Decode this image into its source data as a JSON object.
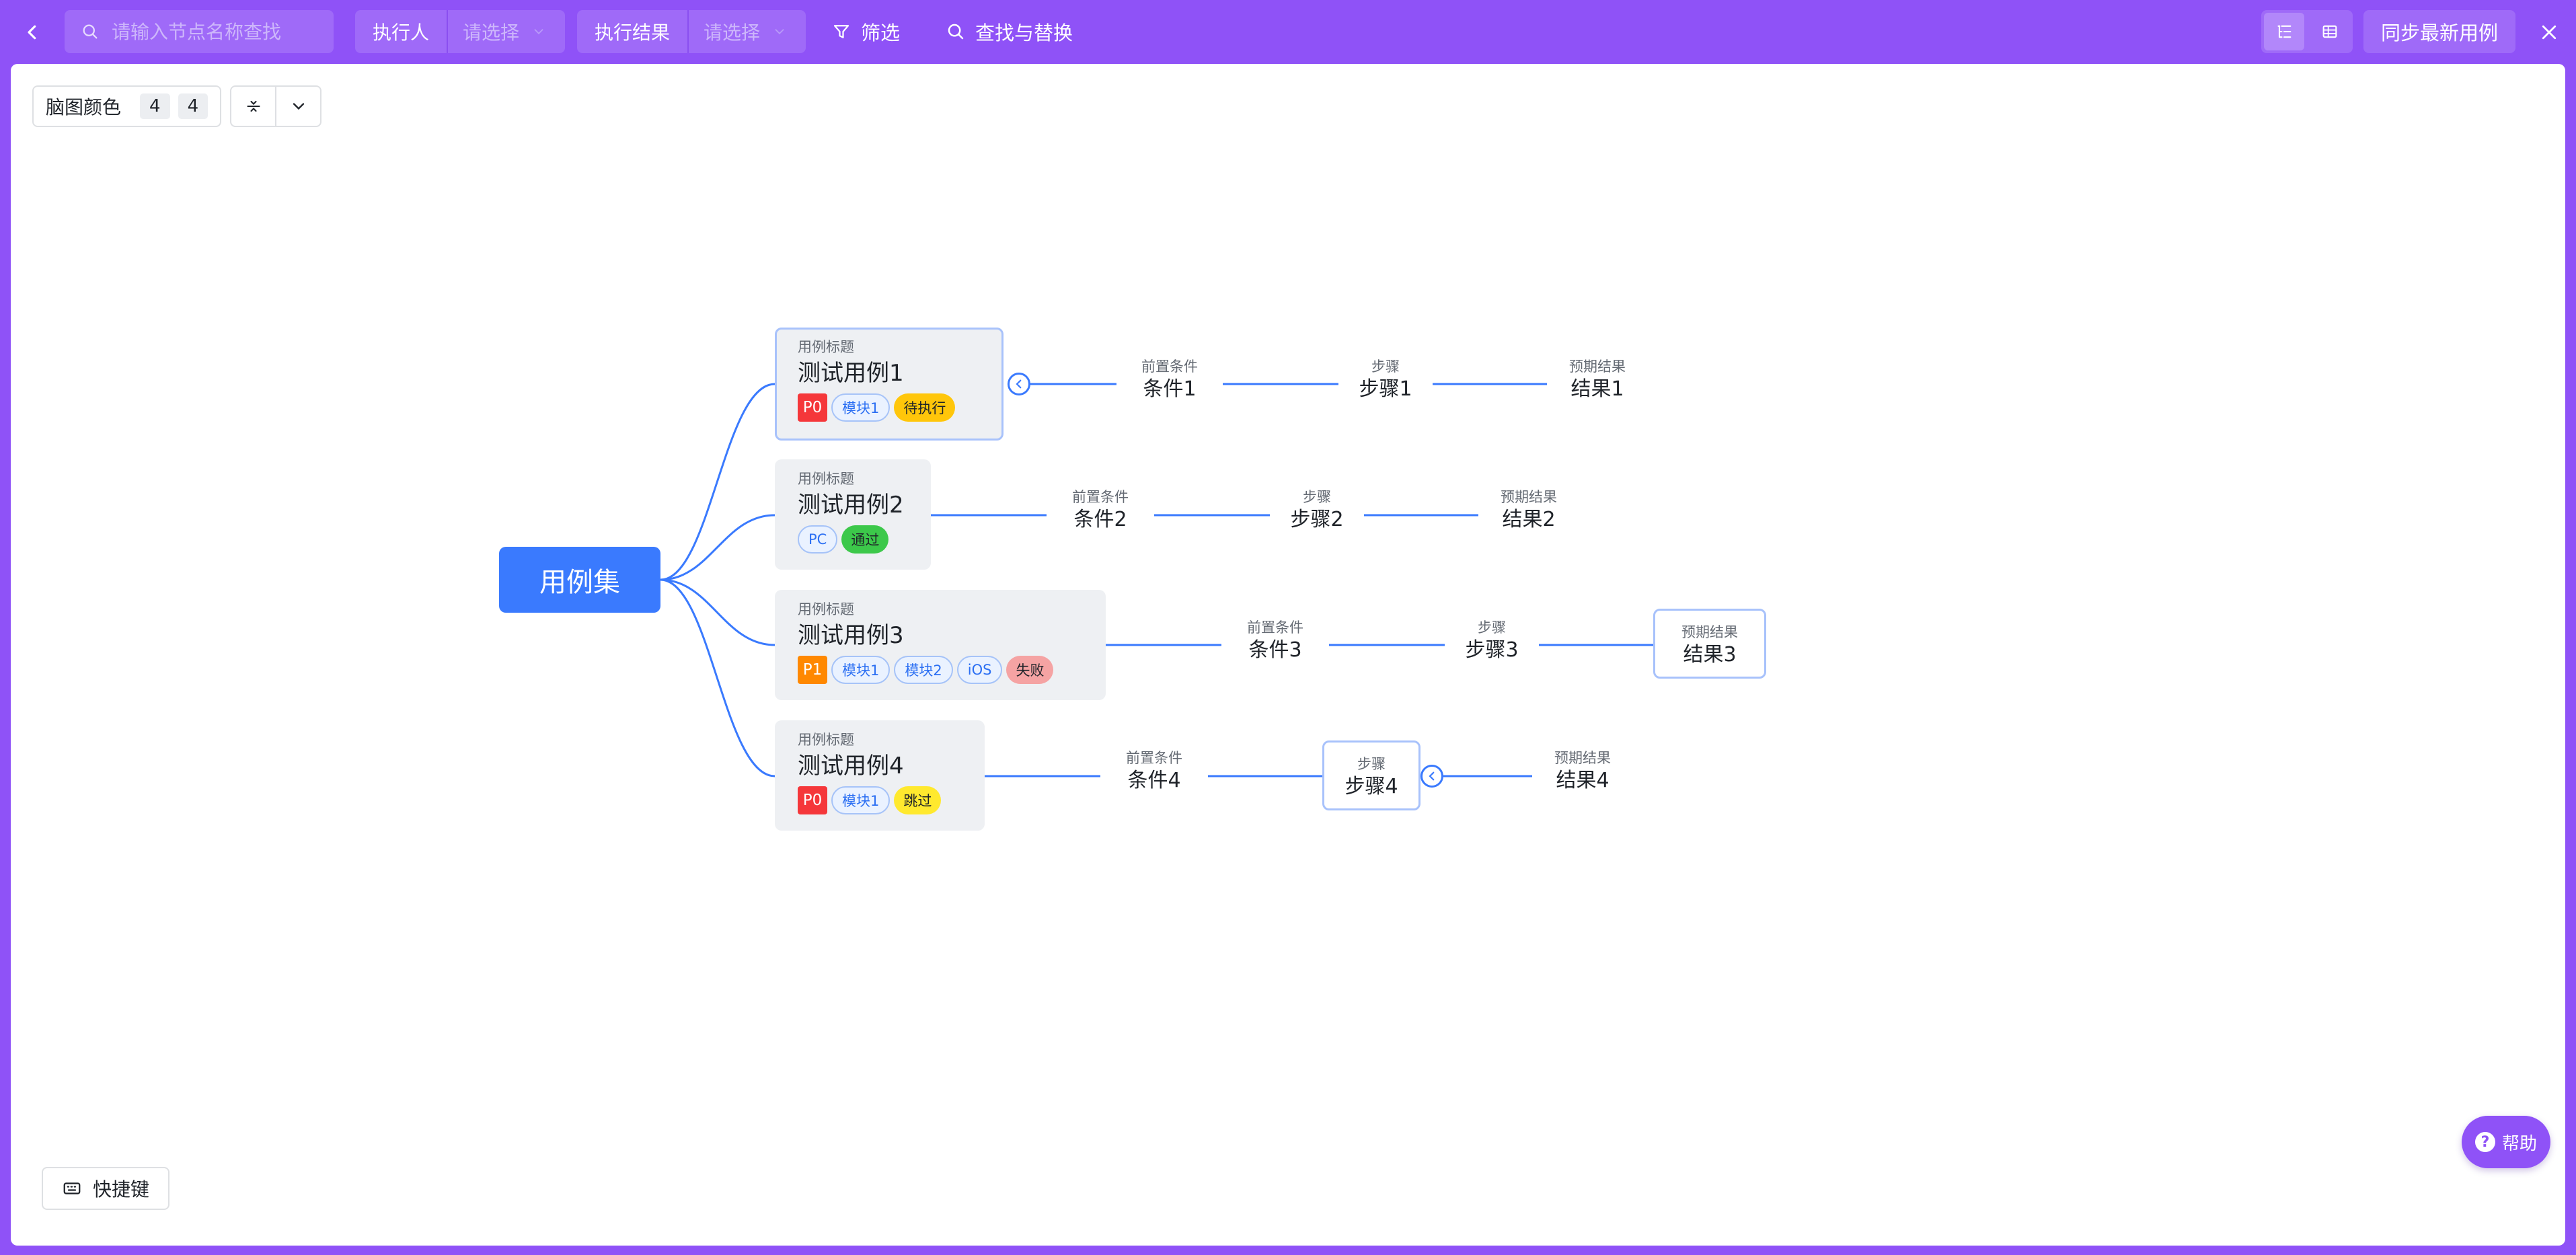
{
  "topbar": {
    "search": {
      "placeholder": "请输入节点名称查找"
    },
    "executor": {
      "label": "执行人",
      "placeholder": "请选择"
    },
    "result": {
      "label": "执行结果",
      "placeholder": "请选择"
    },
    "filter_label": "筛选",
    "find_replace_label": "查找与替换",
    "sync_label": "同步最新用例",
    "view_mode": "mindmap"
  },
  "toolbar": {
    "color_label": "脑图颜色",
    "color_values": [
      "4",
      "4"
    ]
  },
  "mindmap": {
    "root": "用例集",
    "cases": [
      {
        "caption": "用例标题",
        "title": "测试用例1",
        "priority": "P0",
        "modules": [
          "模块1"
        ],
        "status": "待执行",
        "pre_caption": "前置条件",
        "pre": "条件1",
        "step_caption": "步骤",
        "step": "步骤1",
        "expect_caption": "预期结果",
        "expect": "结果1"
      },
      {
        "caption": "用例标题",
        "title": "测试用例2",
        "priority": "",
        "modules": [
          "PC"
        ],
        "status": "通过",
        "pre_caption": "前置条件",
        "pre": "条件2",
        "step_caption": "步骤",
        "step": "步骤2",
        "expect_caption": "预期结果",
        "expect": "结果2"
      },
      {
        "caption": "用例标题",
        "title": "测试用例3",
        "priority": "P1",
        "modules": [
          "模块1",
          "模块2",
          "iOS"
        ],
        "status": "失败",
        "pre_caption": "前置条件",
        "pre": "条件3",
        "step_caption": "步骤",
        "step": "步骤3",
        "expect_caption": "预期结果",
        "expect": "结果3"
      },
      {
        "caption": "用例标题",
        "title": "测试用例4",
        "priority": "P0",
        "modules": [
          "模块1"
        ],
        "status": "跳过",
        "pre_caption": "前置条件",
        "pre": "条件4",
        "step_caption": "步骤",
        "step": "步骤4",
        "expect_caption": "预期结果",
        "expect": "结果4"
      }
    ]
  },
  "footer": {
    "shortcut_label": "快捷键",
    "help_label": "帮助"
  },
  "colors": {
    "brand": "#8f52f7",
    "node_blue": "#3a7afe",
    "priority_p0": "#f5373a",
    "priority_p1": "#ff8800",
    "status_pending": "#ffc60a",
    "status_pass": "#3cc84a",
    "status_fail": "#f5a3a3",
    "status_skip": "#ffe92e"
  }
}
